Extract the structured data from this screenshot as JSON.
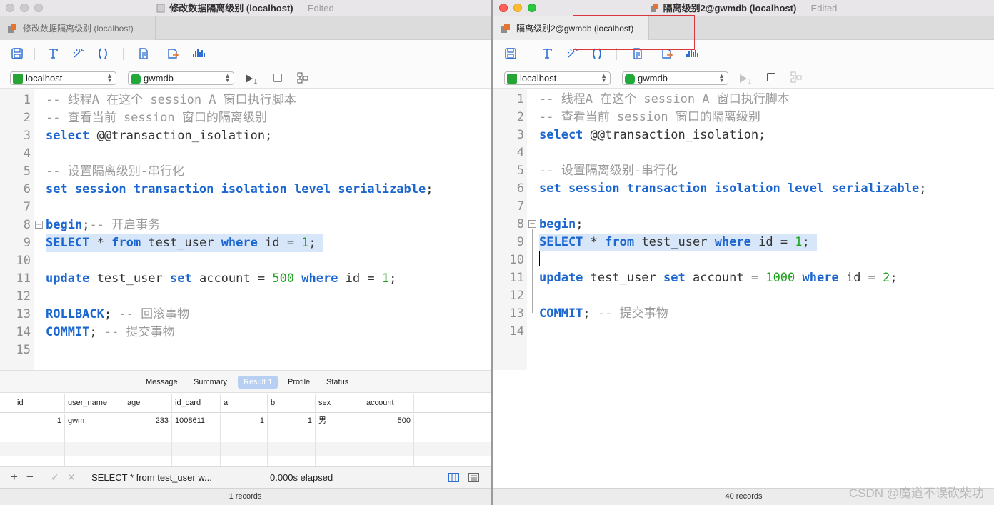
{
  "left": {
    "title": "修改数据隔离级别 (localhost)",
    "edited": "— Edited",
    "tab_label": "修改数据隔离级别 (localhost)",
    "connection": "localhost",
    "database": "gwmdb",
    "code_lines": [
      [
        {
          "t": "c",
          "v": "-- 线程A 在这个 session A 窗口执行脚本"
        }
      ],
      [
        {
          "t": "c",
          "v": "-- 查看当前 session 窗口的隔离级别"
        }
      ],
      [
        {
          "t": "k",
          "v": "select"
        },
        {
          "t": "t",
          "v": " @@transaction_isolation;"
        }
      ],
      [],
      [
        {
          "t": "c",
          "v": "-- 设置隔离级别-串行化"
        }
      ],
      [
        {
          "t": "k",
          "v": "set session transaction isolation level serializable"
        },
        {
          "t": "t",
          "v": ";"
        }
      ],
      [],
      [
        {
          "t": "k",
          "v": "begin"
        },
        {
          "t": "t",
          "v": ";"
        },
        {
          "t": "c",
          "v": "-- 开启事务"
        }
      ],
      [
        {
          "t": "k",
          "v": "SELECT"
        },
        {
          "t": "t",
          "v": " * "
        },
        {
          "t": "k",
          "v": "from"
        },
        {
          "t": "t",
          "v": " test_user "
        },
        {
          "t": "k",
          "v": "where"
        },
        {
          "t": "t",
          "v": " id = "
        },
        {
          "t": "n",
          "v": "1"
        },
        {
          "t": "t",
          "v": "; "
        }
      ],
      [],
      [
        {
          "t": "k",
          "v": "update"
        },
        {
          "t": "t",
          "v": " test_user "
        },
        {
          "t": "k",
          "v": "set"
        },
        {
          "t": "t",
          "v": " account = "
        },
        {
          "t": "n",
          "v": "500"
        },
        {
          "t": "t",
          "v": " "
        },
        {
          "t": "k",
          "v": "where"
        },
        {
          "t": "t",
          "v": " id = "
        },
        {
          "t": "n",
          "v": "1"
        },
        {
          "t": "t",
          "v": ";"
        }
      ],
      [],
      [
        {
          "t": "k",
          "v": "ROLLBACK"
        },
        {
          "t": "t",
          "v": "; "
        },
        {
          "t": "c",
          "v": "-- 回滚事物"
        }
      ],
      [
        {
          "t": "k",
          "v": "COMMIT"
        },
        {
          "t": "t",
          "v": "; "
        },
        {
          "t": "c",
          "v": "-- 提交事物"
        }
      ],
      []
    ],
    "result_tabs": [
      "Message",
      "Summary",
      "Result 1",
      "Profile",
      "Status"
    ],
    "active_result_tab": "Result 1",
    "columns": [
      "id",
      "user_name",
      "age",
      "id_card",
      "a",
      "b",
      "sex",
      "account"
    ],
    "rows": [
      [
        "1",
        "gwm",
        "233",
        "1008611",
        "1",
        "1",
        "男",
        "500"
      ]
    ],
    "footer_sql": "SELECT * from test_user w...",
    "elapsed": "0.000s elapsed",
    "records": "1 records"
  },
  "right": {
    "title": "隔离级别2@gwmdb (localhost)",
    "edited": "— Edited",
    "tab_label": "隔离级别2@gwmdb (localhost)",
    "connection": "localhost",
    "database": "gwmdb",
    "code_lines": [
      [
        {
          "t": "c",
          "v": "-- 线程A 在这个 session A 窗口执行脚本"
        }
      ],
      [
        {
          "t": "c",
          "v": "-- 查看当前 session 窗口的隔离级别"
        }
      ],
      [
        {
          "t": "k",
          "v": "select"
        },
        {
          "t": "t",
          "v": " @@transaction_isolation;"
        }
      ],
      [],
      [
        {
          "t": "c",
          "v": "-- 设置隔离级别-串行化"
        }
      ],
      [
        {
          "t": "k",
          "v": "set session transaction isolation level serializable"
        },
        {
          "t": "t",
          "v": ";"
        }
      ],
      [],
      [
        {
          "t": "k",
          "v": "begin"
        },
        {
          "t": "t",
          "v": ";"
        }
      ],
      [
        {
          "t": "k",
          "v": "SELECT"
        },
        {
          "t": "t",
          "v": " * "
        },
        {
          "t": "k",
          "v": "from"
        },
        {
          "t": "t",
          "v": " test_user "
        },
        {
          "t": "k",
          "v": "where"
        },
        {
          "t": "t",
          "v": " id = "
        },
        {
          "t": "n",
          "v": "1"
        },
        {
          "t": "t",
          "v": "; "
        }
      ],
      [],
      [
        {
          "t": "k",
          "v": "update"
        },
        {
          "t": "t",
          "v": " test_user "
        },
        {
          "t": "k",
          "v": "set"
        },
        {
          "t": "t",
          "v": " account = "
        },
        {
          "t": "n",
          "v": "1000"
        },
        {
          "t": "t",
          "v": " "
        },
        {
          "t": "k",
          "v": "where"
        },
        {
          "t": "t",
          "v": " id = "
        },
        {
          "t": "n",
          "v": "2"
        },
        {
          "t": "t",
          "v": ";"
        }
      ],
      [],
      [
        {
          "t": "k",
          "v": "COMMIT"
        },
        {
          "t": "t",
          "v": "; "
        },
        {
          "t": "c",
          "v": "-- 提交事物"
        }
      ],
      []
    ],
    "records": "40 records"
  },
  "watermark": "CSDN @魔道不误砍柴功",
  "colors": {
    "keyword": "#1b66cf",
    "number": "#1fa21f",
    "comment": "#9a9a9a",
    "highlight": "#d7e6f9",
    "annotation_box": "#d9363e"
  }
}
